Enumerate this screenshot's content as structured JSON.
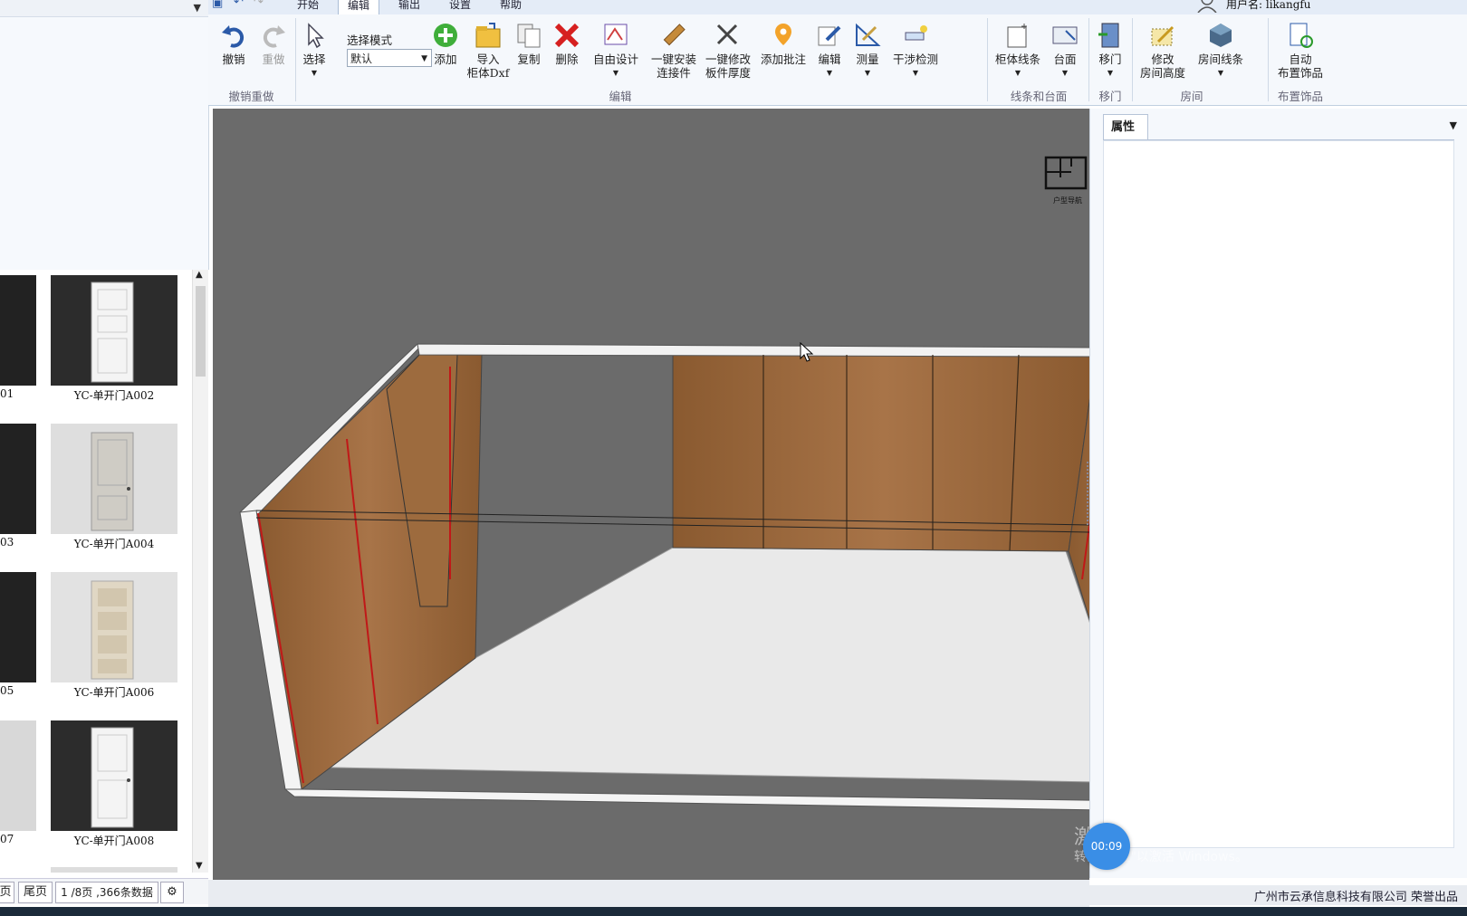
{
  "ribbon_tabs": [
    "开始",
    "编辑",
    "输出",
    "设置",
    "帮助"
  ],
  "active_tab": "编辑",
  "user": {
    "label": "用户名: likangfu"
  },
  "groups": {
    "undo": {
      "label": "撤销重做",
      "undo": "撤销",
      "redo": "重做"
    },
    "edit": {
      "label": "编辑",
      "select": "选择",
      "select_mode_label": "选择模式",
      "select_mode_value": "默认",
      "add": "添加",
      "import_line1": "导入",
      "import_line2": "柜体Dxf",
      "copy": "复制",
      "delete": "删除",
      "free_design": "自由设计",
      "one_click_install_1": "一键安装",
      "one_click_install_2": "连接件",
      "one_click_modify_1": "一键修改",
      "one_click_modify_2": "板件厚度",
      "add_annotation": "添加批注",
      "edit": "编辑",
      "measure": "测量",
      "interference": "干涉检测"
    },
    "lines": {
      "label": "线条和台面",
      "cabinet_lines": "柜体线条",
      "countertop": "台面"
    },
    "move_door": {
      "label": "移门",
      "move_door": "移门"
    },
    "room": {
      "label": "房间",
      "modify_height_1": "修改",
      "modify_height_2": "房间高度",
      "room_lines": "房间线条"
    },
    "decor": {
      "label": "布置饰品",
      "auto_1": "自动",
      "auto_2": "布置饰品"
    }
  },
  "gallery": {
    "items": [
      {
        "left_caption": "01",
        "caption": "YC-单开门A002",
        "style": "white-dark"
      },
      {
        "left_caption": "03",
        "caption": "YC-单开门A004",
        "style": "grey-light"
      },
      {
        "left_caption": "05",
        "caption": "YC-单开门A006",
        "style": "beige-light"
      },
      {
        "left_caption": "07",
        "caption": "YC-单开门A008",
        "style": "white-dark"
      }
    ]
  },
  "pager": {
    "prev": "页",
    "last": "尾页",
    "info": "1 /8页 ,366条数据"
  },
  "viewport": {
    "compass_label": "户型导航"
  },
  "properties": {
    "tab": "属性"
  },
  "status": {
    "company": "广州市云承信息科技有限公司 荣誉出品"
  },
  "overlay": {
    "timer": "00:09",
    "watermark1": "激活 Windows",
    "watermark2": "转到\"设置\"以激活 Windows。"
  },
  "colors": {
    "wood": "#9a6a3c",
    "floor": "#e8e8e8",
    "viewport_bg": "#6b6b6b",
    "accent_blue": "#3a8ee6"
  }
}
